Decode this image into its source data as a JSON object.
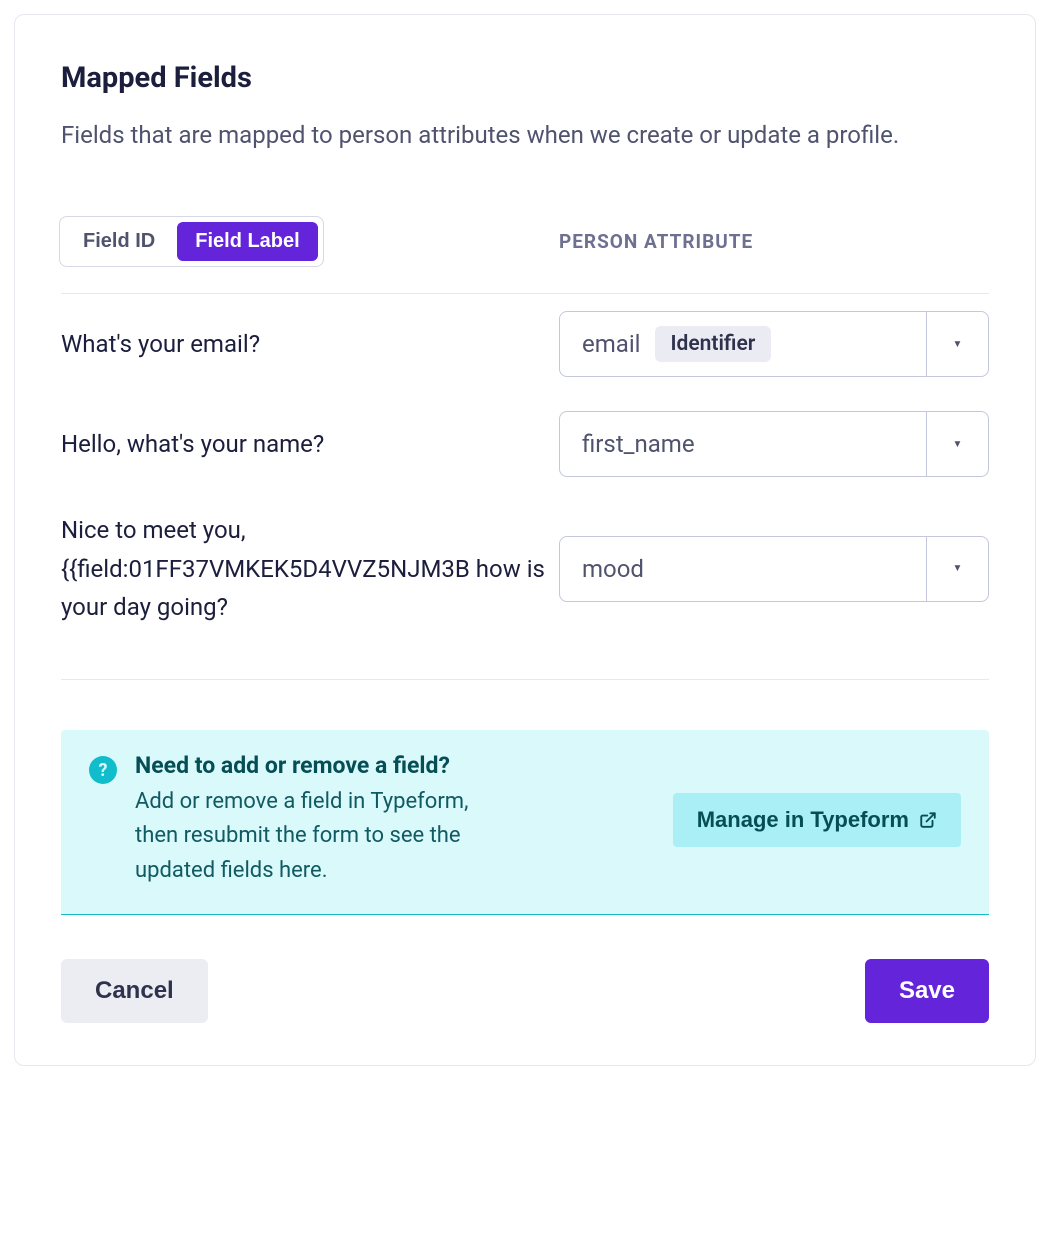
{
  "title": "Mapped Fields",
  "description": "Fields that are mapped to person attributes when we create or update a profile.",
  "toggle": {
    "field_id": "Field ID",
    "field_label": "Field Label"
  },
  "attribute_header": "PERSON ATTRIBUTE",
  "identifier_badge": "Identifier",
  "fields": [
    {
      "label": "What's your email?",
      "attribute": "email",
      "identifier": true
    },
    {
      "label": "Hello, what's your name?",
      "attribute": "first_name",
      "identifier": false
    },
    {
      "label": "Nice to meet you, {{field:01FF37VMKEK5D4VVZ5NJM3B how is your day going?",
      "attribute": "mood",
      "identifier": false
    }
  ],
  "info": {
    "title": "Need to add or remove a field?",
    "desc": "Add or remove a field in Typeform, then resubmit the form to see the updated fields here.",
    "button": "Manage in Typeform"
  },
  "footer": {
    "cancel": "Cancel",
    "save": "Save"
  }
}
